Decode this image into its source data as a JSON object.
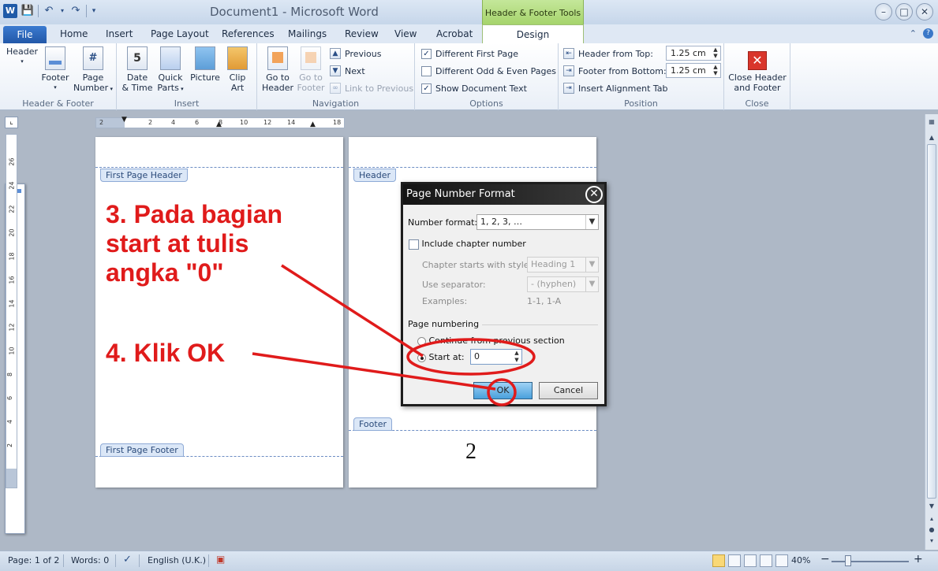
{
  "window": {
    "title_doc": "Document1",
    "title_sep": "-",
    "title_app": "Microsoft Word",
    "contextual_tab_group": "Header & Footer Tools",
    "word_logo": "W",
    "minimize": "–",
    "maximize": "□",
    "close": "✕"
  },
  "tabs": {
    "file": "File",
    "home": "Home",
    "insert": "Insert",
    "page_layout": "Page Layout",
    "references": "References",
    "mailings": "Mailings",
    "review": "Review",
    "view": "View",
    "acrobat": "Acrobat",
    "design": "Design"
  },
  "ribbon": {
    "header_footer": {
      "label": "Header & Footer",
      "header": "Header",
      "footer": "Footer",
      "page": "Page",
      "number": "Number",
      "num_glyph": "#"
    },
    "insert": {
      "label": "Insert",
      "date": "Date",
      "time": "& Time",
      "date_glyph": "5",
      "quick": "Quick",
      "parts": "Parts",
      "picture": "Picture",
      "clip": "Clip",
      "art": "Art"
    },
    "navigation": {
      "label": "Navigation",
      "goto_header_1": "Go to",
      "goto_header_2": "Header",
      "goto_footer_1": "Go to",
      "goto_footer_2": "Footer",
      "previous": "Previous",
      "next": "Next",
      "link_previous": "Link to Previous"
    },
    "options": {
      "label": "Options",
      "different_first_page": "Different First Page",
      "different_first_page_checked": true,
      "different_odd_even": "Different Odd & Even Pages",
      "different_odd_even_checked": false,
      "show_document_text": "Show Document Text",
      "show_document_text_checked": true
    },
    "position": {
      "label": "Position",
      "header_from_top": "Header from Top:",
      "header_from_top_value": "1.25 cm",
      "footer_from_bottom": "Footer from Bottom:",
      "footer_from_bottom_value": "1.25 cm",
      "insert_alignment_tab": "Insert Alignment Tab"
    },
    "close": {
      "label": "Close",
      "close_1": "Close Header",
      "close_2": "and Footer",
      "close_glyph": "✕"
    }
  },
  "ruler": {
    "h_ticks": [
      "2",
      "2",
      "4",
      "6",
      "8",
      "10",
      "12",
      "14",
      "18"
    ],
    "v_ticks": [
      "26",
      "24",
      "22",
      "20",
      "18",
      "16",
      "14",
      "12",
      "10",
      "8",
      "6",
      "4",
      "2"
    ]
  },
  "pages": {
    "first_page_header": "First Page Header",
    "first_page_footer": "First Page Footer",
    "header": "Header",
    "footer": "Footer",
    "page_number": "2"
  },
  "annotations": {
    "step3_line1": "3. Pada bagian",
    "step3_line2": "start at tulis",
    "step3_line3": "angka \"0\"",
    "step4": "4. Klik OK",
    "color": "#e01b1b"
  },
  "dialog": {
    "title": "Page Number Format",
    "close_glyph": "✕",
    "number_format_label": "Number format:",
    "number_format_value": "1, 2, 3, …",
    "include_chapter_number": "Include chapter number",
    "chapter_starts_label": "Chapter starts with style:",
    "chapter_starts_value": "Heading 1",
    "use_separator_label": "Use separator:",
    "use_separator_value": "-   (hyphen)",
    "examples_label": "Examples:",
    "examples_value": "1-1, 1-A",
    "page_numbering_label": "Page numbering",
    "continue_label": "Continue from previous section",
    "start_at_label": "Start at:",
    "start_at_value": "0",
    "ok": "OK",
    "cancel": "Cancel"
  },
  "statusbar": {
    "page": "Page: 1 of 2",
    "words": "Words: 0",
    "language": "English (U.K.)",
    "zoom": "40%",
    "zoom_minus": "−",
    "zoom_plus": "+"
  }
}
